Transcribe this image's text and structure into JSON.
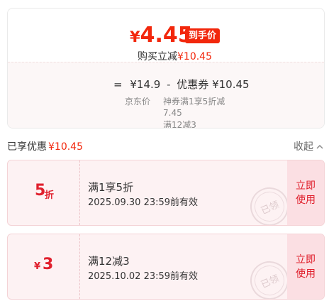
{
  "price_panel": {
    "final_currency": "¥",
    "final_amount": "4.45",
    "final_tag": "到手价",
    "instant_reduce_label": "购买立减",
    "instant_reduce_amount": "¥10.45",
    "equation_eq": "=",
    "jd_price": "¥14.9",
    "equation_minus": "-",
    "coupon_label": "优惠券",
    "coupon_total": "¥10.45",
    "jd_price_label": "京东价",
    "coupon_desc_line1": "神券满1享5折减",
    "coupon_desc_line2": "7.45",
    "coupon_desc_line3": "满12减3"
  },
  "discount_summary": {
    "label": "已享优惠",
    "amount": "¥10.45",
    "collapse_label": "收起",
    "collapse_icon": "chevron-up-icon"
  },
  "coupons": [
    {
      "face_value": "5",
      "face_unit": "折",
      "title": "满1享5折",
      "validity": "2025.09.30 23:59前有效",
      "button_line1": "立即",
      "button_line2": "使用",
      "stamp": "已领"
    },
    {
      "face_currency": "¥",
      "face_value": "3",
      "title": "满12减3",
      "validity": "2025.10.02 23:59前有效",
      "button_line1": "立即",
      "button_line2": "使用",
      "stamp": "已领"
    }
  ],
  "colors": {
    "accent": "#f2270c",
    "coupon_bg": "#fdf2f3",
    "coupon_button_bg": "#fbdfe3"
  }
}
